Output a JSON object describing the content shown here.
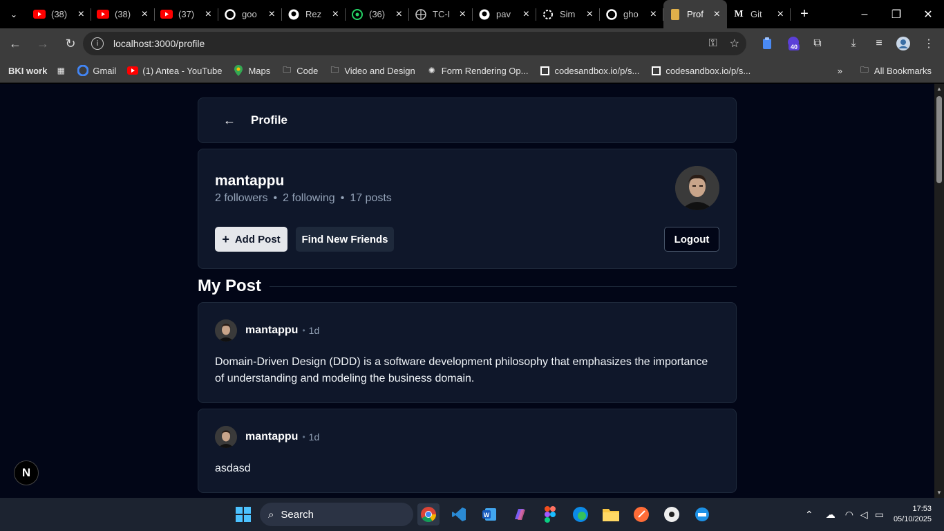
{
  "browser": {
    "tabs": [
      {
        "title": "(38)",
        "icon": "youtube-icon",
        "color": "#ff0000"
      },
      {
        "title": "(38)",
        "icon": "youtube-icon",
        "color": "#ff0000"
      },
      {
        "title": "(37)",
        "icon": "youtube-icon",
        "color": "#ff0000"
      },
      {
        "title": "goo",
        "icon": "google-icon",
        "color": "#ffffff"
      },
      {
        "title": "Rez",
        "icon": "github-icon",
        "color": "#ffffff"
      },
      {
        "title": "(36)",
        "icon": "whatsapp-icon",
        "color": "#25d366"
      },
      {
        "title": "TC-I",
        "icon": "globe-icon",
        "color": "#cccccc"
      },
      {
        "title": "pav",
        "icon": "github-icon",
        "color": "#ffffff"
      },
      {
        "title": "Sim",
        "icon": "openai-icon",
        "color": "#ffffff"
      },
      {
        "title": "gho",
        "icon": "google-icon",
        "color": "#ffffff"
      },
      {
        "title": "Prof",
        "icon": "page-icon",
        "color": "#e0b04a",
        "active": true
      },
      {
        "title": "Git",
        "icon": "medium-icon",
        "color": "#ffffff"
      }
    ],
    "url": "localhost:3000/profile",
    "extension_badge": "40",
    "bookmarks": [
      {
        "label": "BKI work",
        "icon": ""
      },
      {
        "label": "",
        "icon": "apps-grid-icon"
      },
      {
        "label": "Gmail",
        "icon": "google-icon"
      },
      {
        "label": "(1) Antea - YouTube",
        "icon": "youtube-icon"
      },
      {
        "label": "Maps",
        "icon": "maps-icon"
      },
      {
        "label": "Code",
        "icon": "folder-icon"
      },
      {
        "label": "Video and Design",
        "icon": "folder-icon"
      },
      {
        "label": "Form Rendering Op...",
        "icon": "openai-icon"
      },
      {
        "label": "codesandbox.io/p/s...",
        "icon": "codesandbox-icon"
      },
      {
        "label": "codesandbox.io/p/s...",
        "icon": "codesandbox-icon"
      }
    ],
    "all_bookmarks": "All Bookmarks"
  },
  "page": {
    "header_title": "Profile",
    "username": "mantappu",
    "followers": "2 followers",
    "following": "2 following",
    "posts_count": "17 posts",
    "add_post": "Add Post",
    "find_friends": "Find New Friends",
    "logout": "Logout",
    "section_title": "My Post",
    "posts": [
      {
        "author": "mantappu",
        "time": "1d",
        "body": "Domain-Driven Design (DDD) is a software development philosophy that emphasizes the importance of understanding and modeling the business domain."
      },
      {
        "author": "mantappu",
        "time": "1d",
        "body": "asdasd"
      }
    ],
    "dev_badge": "N"
  },
  "taskbar": {
    "search_label": "Search",
    "time": "17:53",
    "date": "05/10/2025"
  }
}
